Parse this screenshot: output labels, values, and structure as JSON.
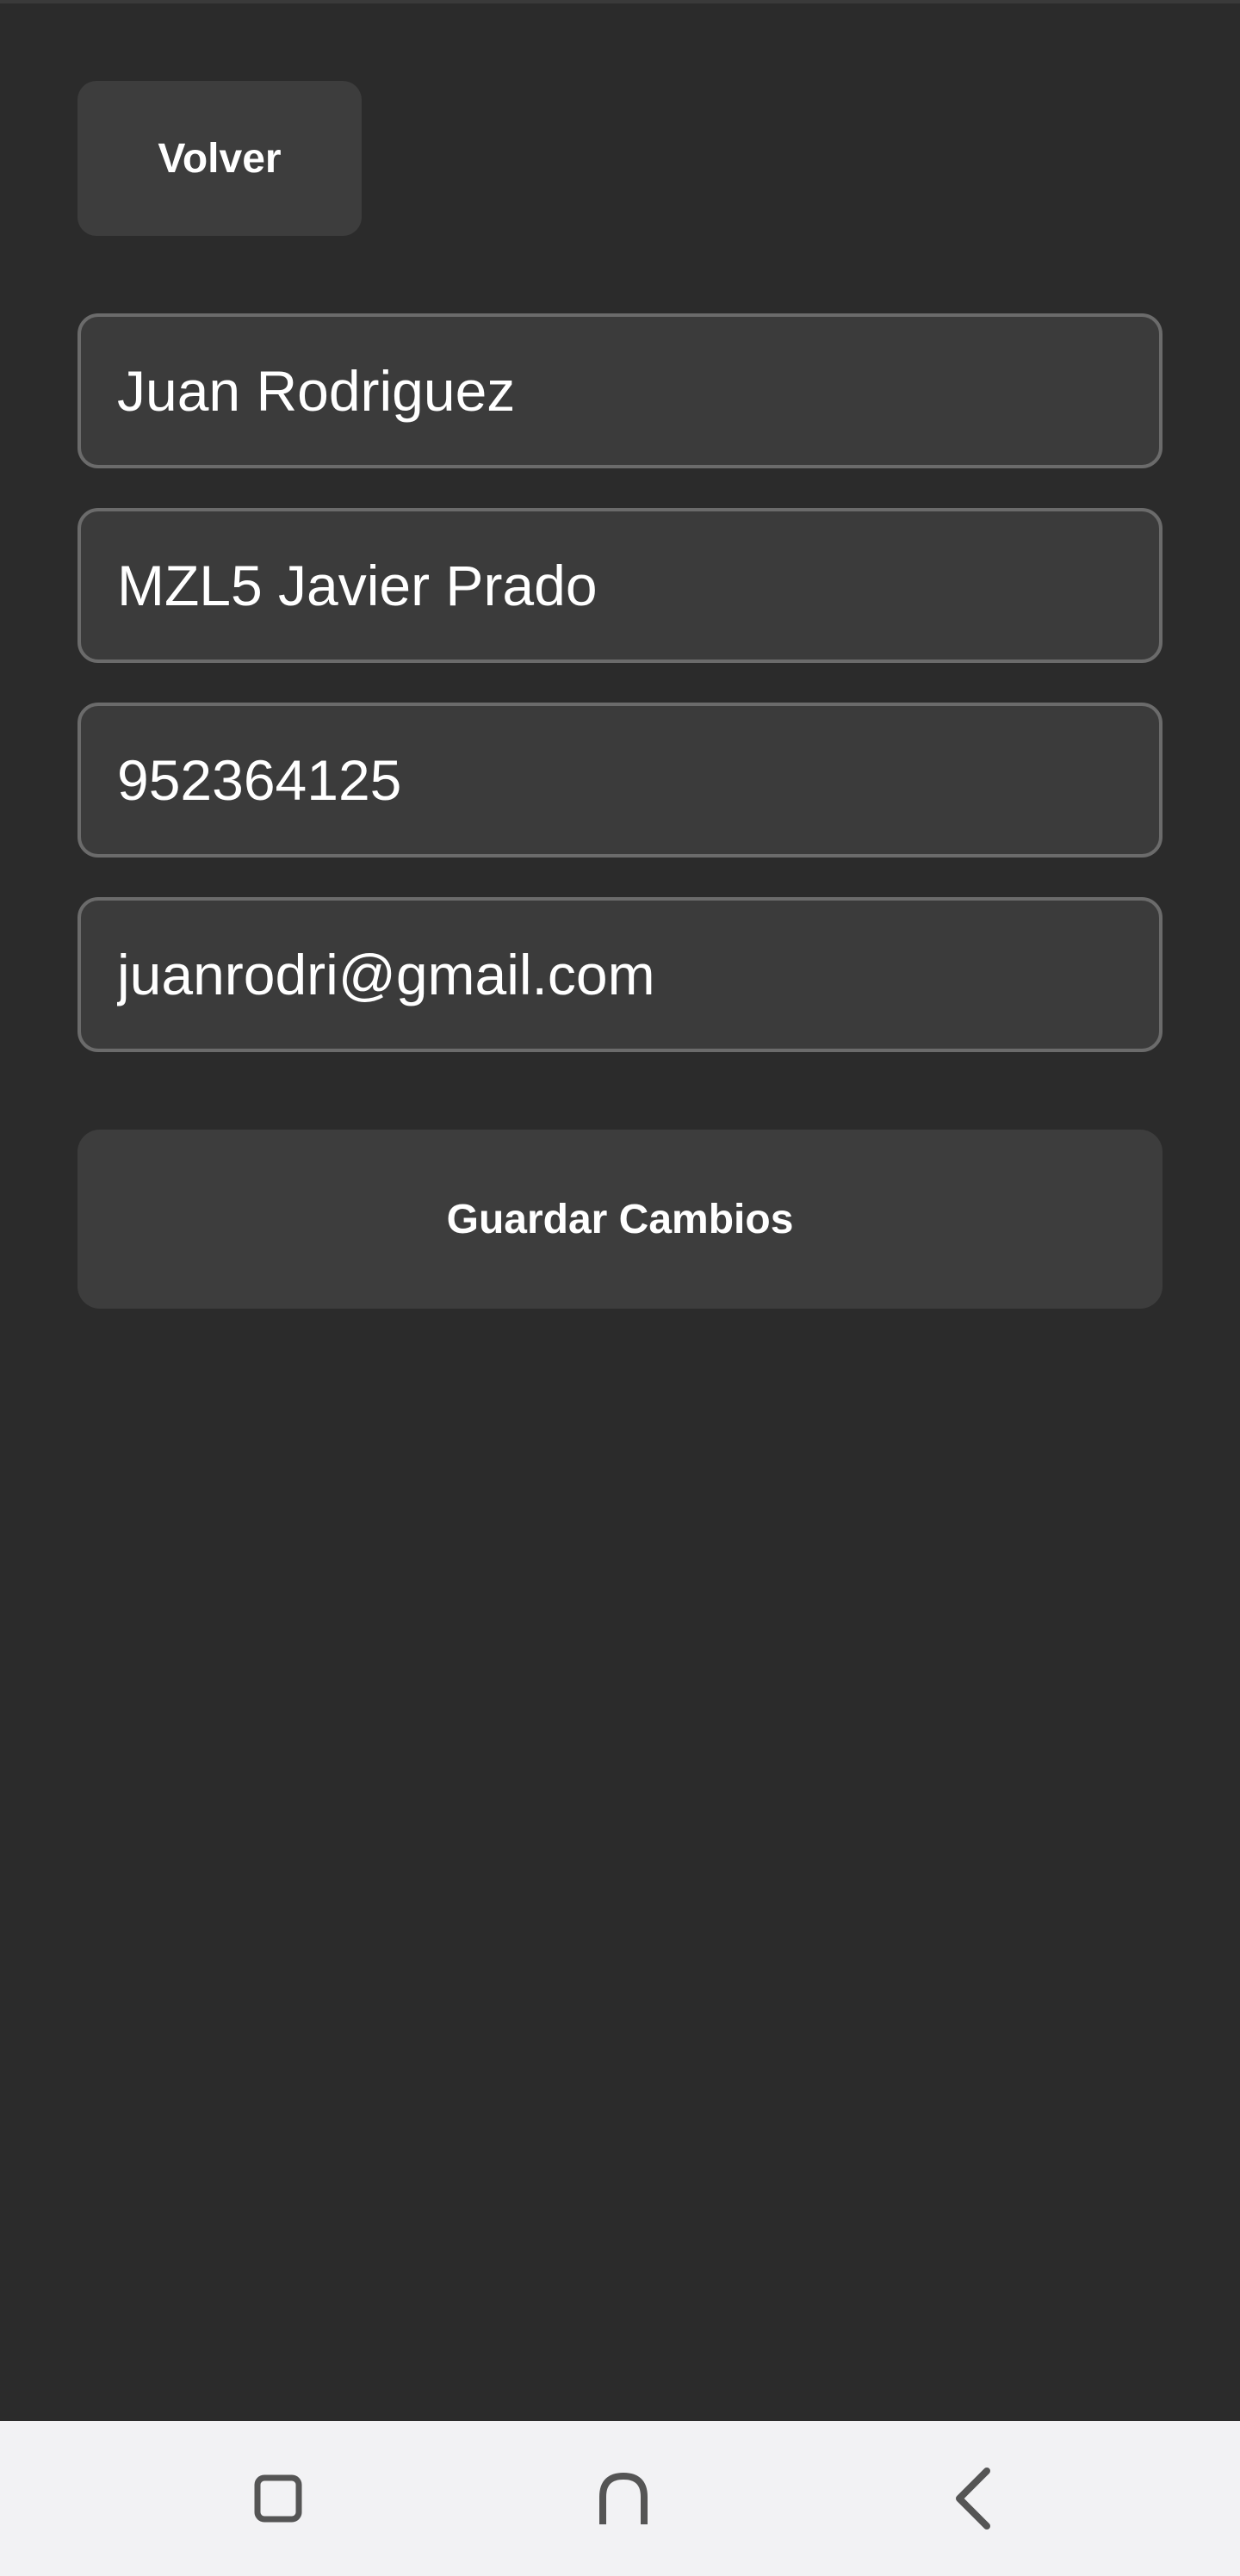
{
  "header": {
    "back_label": "Volver"
  },
  "form": {
    "name": "Juan Rodriguez",
    "address": "MZL5 Javier Prado",
    "phone": "952364125",
    "email": "juanrodri@gmail.com",
    "save_label": "Guardar Cambios"
  },
  "nav_bar": {
    "items": [
      {
        "icon": "recents-icon"
      },
      {
        "icon": "home-icon"
      },
      {
        "icon": "back-icon"
      }
    ]
  },
  "colors": {
    "background": "#2b2b2b",
    "surface": "#3d3d3d",
    "field_border": "#6b6b6b",
    "text": "#ffffff",
    "nav_bar": "#f2f2f4",
    "nav_icon": "#555555"
  }
}
